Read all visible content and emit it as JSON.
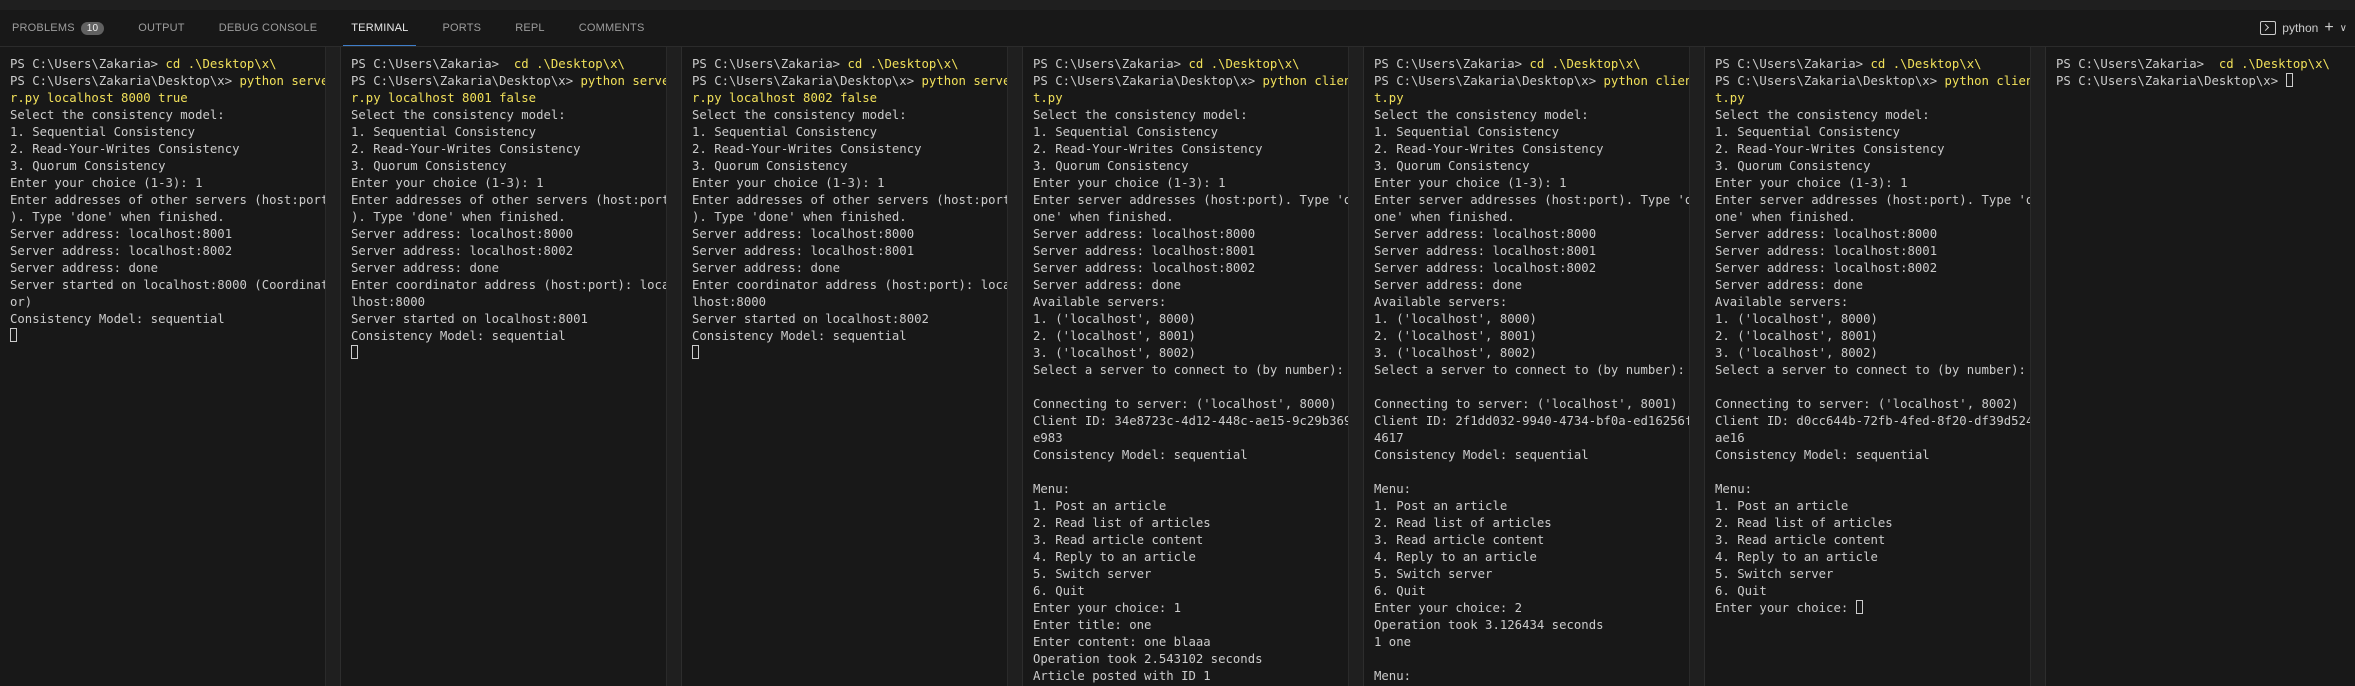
{
  "tabs": [
    {
      "label": "PROBLEMS",
      "badge": "10"
    },
    {
      "label": "OUTPUT"
    },
    {
      "label": "DEBUG CONSOLE"
    },
    {
      "label": "TERMINAL"
    },
    {
      "label": "PORTS"
    },
    {
      "label": "REPL"
    },
    {
      "label": "COMMENTS"
    }
  ],
  "active_tab": "TERMINAL",
  "terminal_profile": "python",
  "colors": {
    "command": "#f1e05a",
    "text": "#cccccc",
    "accent": "#3f7ec9"
  },
  "panes": [
    {
      "lines": [
        [
          {
            "t": "PS C:\\Users\\Zakaria> "
          },
          {
            "t": "cd .\\Desktop\\x\\",
            "c": 1
          }
        ],
        [
          {
            "t": "PS C:\\Users\\Zakaria\\Desktop\\x> "
          },
          {
            "t": "python serve",
            "c": 1
          }
        ],
        [
          {
            "t": "r.py localhost 8000 true",
            "c": 1
          }
        ],
        [
          {
            "t": "Select the consistency model:"
          }
        ],
        [
          {
            "t": "1. Sequential Consistency"
          }
        ],
        [
          {
            "t": "2. Read-Your-Writes Consistency"
          }
        ],
        [
          {
            "t": "3. Quorum Consistency"
          }
        ],
        [
          {
            "t": "Enter your choice (1-3): 1"
          }
        ],
        [
          {
            "t": "Enter addresses of other servers (host:port"
          }
        ],
        [
          {
            "t": "). Type 'done' when finished."
          }
        ],
        [
          {
            "t": "Server address: localhost:8001"
          }
        ],
        [
          {
            "t": "Server address: localhost:8002"
          }
        ],
        [
          {
            "t": "Server address: done"
          }
        ],
        [
          {
            "t": "Server started on localhost:8000 (Coordinat"
          }
        ],
        [
          {
            "t": "or)"
          }
        ],
        [
          {
            "t": "Consistency Model: sequential"
          }
        ],
        [
          {
            "cursor": true
          }
        ]
      ]
    },
    {
      "lines": [
        [
          {
            "t": "PS C:\\Users\\Zakaria>  "
          },
          {
            "t": "cd .\\Desktop\\x\\",
            "c": 1
          }
        ],
        [
          {
            "t": "PS C:\\Users\\Zakaria\\Desktop\\x> "
          },
          {
            "t": "python serve",
            "c": 1
          }
        ],
        [
          {
            "t": "r.py localhost 8001 false",
            "c": 1
          }
        ],
        [
          {
            "t": "Select the consistency model:"
          }
        ],
        [
          {
            "t": "1. Sequential Consistency"
          }
        ],
        [
          {
            "t": "2. Read-Your-Writes Consistency"
          }
        ],
        [
          {
            "t": "3. Quorum Consistency"
          }
        ],
        [
          {
            "t": "Enter your choice (1-3): 1"
          }
        ],
        [
          {
            "t": "Enter addresses of other servers (host:port"
          }
        ],
        [
          {
            "t": "). Type 'done' when finished."
          }
        ],
        [
          {
            "t": "Server address: localhost:8000"
          }
        ],
        [
          {
            "t": "Server address: localhost:8002"
          }
        ],
        [
          {
            "t": "Server address: done"
          }
        ],
        [
          {
            "t": "Enter coordinator address (host:port): loca"
          }
        ],
        [
          {
            "t": "lhost:8000"
          }
        ],
        [
          {
            "t": "Server started on localhost:8001"
          }
        ],
        [
          {
            "t": "Consistency Model: sequential"
          }
        ],
        [
          {
            "cursor": true
          }
        ]
      ]
    },
    {
      "lines": [
        [
          {
            "t": "PS C:\\Users\\Zakaria> "
          },
          {
            "t": "cd .\\Desktop\\x\\",
            "c": 1
          }
        ],
        [
          {
            "t": "PS C:\\Users\\Zakaria\\Desktop\\x> "
          },
          {
            "t": "python serve",
            "c": 1
          }
        ],
        [
          {
            "t": "r.py localhost 8002 false",
            "c": 1
          }
        ],
        [
          {
            "t": "Select the consistency model:"
          }
        ],
        [
          {
            "t": "1. Sequential Consistency"
          }
        ],
        [
          {
            "t": "2. Read-Your-Writes Consistency"
          }
        ],
        [
          {
            "t": "3. Quorum Consistency"
          }
        ],
        [
          {
            "t": "Enter your choice (1-3): 1"
          }
        ],
        [
          {
            "t": "Enter addresses of other servers (host:port"
          }
        ],
        [
          {
            "t": "). Type 'done' when finished."
          }
        ],
        [
          {
            "t": "Server address: localhost:8000"
          }
        ],
        [
          {
            "t": "Server address: localhost:8001"
          }
        ],
        [
          {
            "t": "Server address: done"
          }
        ],
        [
          {
            "t": "Enter coordinator address (host:port): loca"
          }
        ],
        [
          {
            "t": "lhost:8000"
          }
        ],
        [
          {
            "t": "Server started on localhost:8002"
          }
        ],
        [
          {
            "t": "Consistency Model: sequential"
          }
        ],
        [
          {
            "cursor": true
          }
        ]
      ]
    },
    {
      "lines": [
        [
          {
            "t": "PS C:\\Users\\Zakaria> "
          },
          {
            "t": "cd .\\Desktop\\x\\",
            "c": 1
          }
        ],
        [
          {
            "t": "PS C:\\Users\\Zakaria\\Desktop\\x> "
          },
          {
            "t": "python clien",
            "c": 1
          }
        ],
        [
          {
            "t": "t.py",
            "c": 1
          }
        ],
        [
          {
            "t": "Select the consistency model:"
          }
        ],
        [
          {
            "t": "1. Sequential Consistency"
          }
        ],
        [
          {
            "t": "2. Read-Your-Writes Consistency"
          }
        ],
        [
          {
            "t": "3. Quorum Consistency"
          }
        ],
        [
          {
            "t": "Enter your choice (1-3): 1"
          }
        ],
        [
          {
            "t": "Enter server addresses (host:port). Type 'd"
          }
        ],
        [
          {
            "t": "one' when finished."
          }
        ],
        [
          {
            "t": "Server address: localhost:8000"
          }
        ],
        [
          {
            "t": "Server address: localhost:8001"
          }
        ],
        [
          {
            "t": "Server address: localhost:8002"
          }
        ],
        [
          {
            "t": "Server address: done"
          }
        ],
        [
          {
            "t": "Available servers:"
          }
        ],
        [
          {
            "t": "1. ('localhost', 8000)"
          }
        ],
        [
          {
            "t": "2. ('localhost', 8001)"
          }
        ],
        [
          {
            "t": "3. ('localhost', 8002)"
          }
        ],
        [
          {
            "t": "Select a server to connect to (by number):"
          }
        ],
        [
          {
            "t": ""
          }
        ],
        [
          {
            "t": "Connecting to server: ('localhost', 8000)"
          }
        ],
        [
          {
            "t": "Client ID: 34e8723c-4d12-448c-ae15-9c29b369"
          }
        ],
        [
          {
            "t": "e983"
          }
        ],
        [
          {
            "t": "Consistency Model: sequential"
          }
        ],
        [
          {
            "t": ""
          }
        ],
        [
          {
            "t": "Menu:"
          }
        ],
        [
          {
            "t": "1. Post an article"
          }
        ],
        [
          {
            "t": "2. Read list of articles"
          }
        ],
        [
          {
            "t": "3. Read article content"
          }
        ],
        [
          {
            "t": "4. Reply to an article"
          }
        ],
        [
          {
            "t": "5. Switch server"
          }
        ],
        [
          {
            "t": "6. Quit"
          }
        ],
        [
          {
            "t": "Enter your choice: 1"
          }
        ],
        [
          {
            "t": "Enter title: one"
          }
        ],
        [
          {
            "t": "Enter content: one blaaa"
          }
        ],
        [
          {
            "t": "Operation took 2.543102 seconds"
          }
        ],
        [
          {
            "t": "Article posted with ID 1"
          }
        ]
      ]
    },
    {
      "lines": [
        [
          {
            "t": "PS C:\\Users\\Zakaria> "
          },
          {
            "t": "cd .\\Desktop\\x\\",
            "c": 1
          }
        ],
        [
          {
            "t": "PS C:\\Users\\Zakaria\\Desktop\\x> "
          },
          {
            "t": "python clien",
            "c": 1
          }
        ],
        [
          {
            "t": "t.py",
            "c": 1
          }
        ],
        [
          {
            "t": "Select the consistency model:"
          }
        ],
        [
          {
            "t": "1. Sequential Consistency"
          }
        ],
        [
          {
            "t": "2. Read-Your-Writes Consistency"
          }
        ],
        [
          {
            "t": "3. Quorum Consistency"
          }
        ],
        [
          {
            "t": "Enter your choice (1-3): 1"
          }
        ],
        [
          {
            "t": "Enter server addresses (host:port). Type 'd"
          }
        ],
        [
          {
            "t": "one' when finished."
          }
        ],
        [
          {
            "t": "Server address: localhost:8000"
          }
        ],
        [
          {
            "t": "Server address: localhost:8001"
          }
        ],
        [
          {
            "t": "Server address: localhost:8002"
          }
        ],
        [
          {
            "t": "Server address: done"
          }
        ],
        [
          {
            "t": "Available servers:"
          }
        ],
        [
          {
            "t": "1. ('localhost', 8000)"
          }
        ],
        [
          {
            "t": "2. ('localhost', 8001)"
          }
        ],
        [
          {
            "t": "3. ('localhost', 8002)"
          }
        ],
        [
          {
            "t": "Select a server to connect to (by number):"
          }
        ],
        [
          {
            "t": ""
          }
        ],
        [
          {
            "t": "Connecting to server: ('localhost', 8001)"
          }
        ],
        [
          {
            "t": "Client ID: 2f1dd032-9940-4734-bf0a-ed16256f"
          }
        ],
        [
          {
            "t": "4617"
          }
        ],
        [
          {
            "t": "Consistency Model: sequential"
          }
        ],
        [
          {
            "t": ""
          }
        ],
        [
          {
            "t": "Menu:"
          }
        ],
        [
          {
            "t": "1. Post an article"
          }
        ],
        [
          {
            "t": "2. Read list of articles"
          }
        ],
        [
          {
            "t": "3. Read article content"
          }
        ],
        [
          {
            "t": "4. Reply to an article"
          }
        ],
        [
          {
            "t": "5. Switch server"
          }
        ],
        [
          {
            "t": "6. Quit"
          }
        ],
        [
          {
            "t": "Enter your choice: 2"
          }
        ],
        [
          {
            "t": "Operation took 3.126434 seconds"
          }
        ],
        [
          {
            "t": "1 one"
          }
        ],
        [
          {
            "t": ""
          }
        ],
        [
          {
            "t": "Menu:"
          }
        ]
      ]
    },
    {
      "lines": [
        [
          {
            "t": "PS C:\\Users\\Zakaria> "
          },
          {
            "t": "cd .\\Desktop\\x\\",
            "c": 1
          }
        ],
        [
          {
            "t": "PS C:\\Users\\Zakaria\\Desktop\\x> "
          },
          {
            "t": "python clien",
            "c": 1
          }
        ],
        [
          {
            "t": "t.py",
            "c": 1
          }
        ],
        [
          {
            "t": "Select the consistency model:"
          }
        ],
        [
          {
            "t": "1. Sequential Consistency"
          }
        ],
        [
          {
            "t": "2. Read-Your-Writes Consistency"
          }
        ],
        [
          {
            "t": "3. Quorum Consistency"
          }
        ],
        [
          {
            "t": "Enter your choice (1-3): 1"
          }
        ],
        [
          {
            "t": "Enter server addresses (host:port). Type 'd"
          }
        ],
        [
          {
            "t": "one' when finished."
          }
        ],
        [
          {
            "t": "Server address: localhost:8000"
          }
        ],
        [
          {
            "t": "Server address: localhost:8001"
          }
        ],
        [
          {
            "t": "Server address: localhost:8002"
          }
        ],
        [
          {
            "t": "Server address: done"
          }
        ],
        [
          {
            "t": "Available servers:"
          }
        ],
        [
          {
            "t": "1. ('localhost', 8000)"
          }
        ],
        [
          {
            "t": "2. ('localhost', 8001)"
          }
        ],
        [
          {
            "t": "3. ('localhost', 8002)"
          }
        ],
        [
          {
            "t": "Select a server to connect to (by number):"
          }
        ],
        [
          {
            "t": ""
          }
        ],
        [
          {
            "t": "Connecting to server: ('localhost', 8002)"
          }
        ],
        [
          {
            "t": "Client ID: d0cc644b-72fb-4fed-8f20-df39d524"
          }
        ],
        [
          {
            "t": "ae16"
          }
        ],
        [
          {
            "t": "Consistency Model: sequential"
          }
        ],
        [
          {
            "t": ""
          }
        ],
        [
          {
            "t": "Menu:"
          }
        ],
        [
          {
            "t": "1. Post an article"
          }
        ],
        [
          {
            "t": "2. Read list of articles"
          }
        ],
        [
          {
            "t": "3. Read article content"
          }
        ],
        [
          {
            "t": "4. Reply to an article"
          }
        ],
        [
          {
            "t": "5. Switch server"
          }
        ],
        [
          {
            "t": "6. Quit"
          }
        ],
        [
          {
            "t": "Enter your choice: "
          },
          {
            "cursor": true
          }
        ]
      ]
    },
    {
      "lines": [
        [
          {
            "t": "PS C:\\Users\\Zakaria>  "
          },
          {
            "t": "cd .\\Desktop\\x\\",
            "c": 1
          }
        ],
        [
          {
            "t": "PS C:\\Users\\Zakaria\\Desktop\\x> "
          },
          {
            "cursor": true
          }
        ]
      ]
    }
  ]
}
